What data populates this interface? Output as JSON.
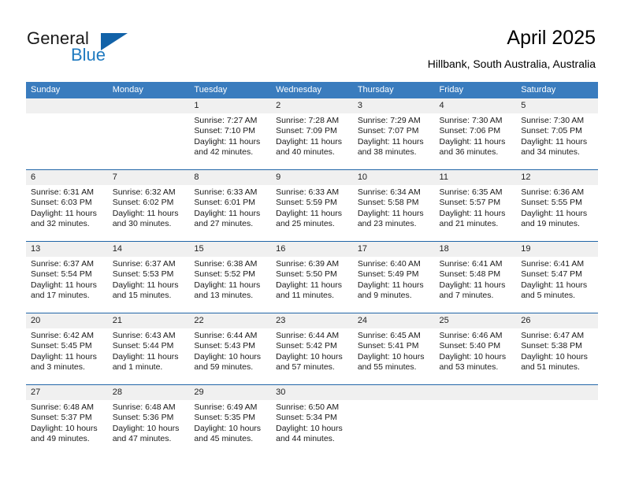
{
  "brand": {
    "line1": "General",
    "line2": "Blue",
    "accent_color": "#1262a8",
    "logo_icon": "triangle-logo-icon"
  },
  "header": {
    "title": "April 2025",
    "subtitle": "Hillbank, South Australia, Australia"
  },
  "theme": {
    "header_row_bg": "#3a7cbe",
    "row_divider": "#2266a8",
    "daynum_band_bg": "#f0f0f0",
    "text": "#000000"
  },
  "calendar": {
    "weekday_headers": [
      "Sunday",
      "Monday",
      "Tuesday",
      "Wednesday",
      "Thursday",
      "Friday",
      "Saturday"
    ],
    "weeks": [
      [
        {
          "day": "",
          "sunrise": "",
          "sunset": "",
          "daylight1": "",
          "daylight2": ""
        },
        {
          "day": "",
          "sunrise": "",
          "sunset": "",
          "daylight1": "",
          "daylight2": ""
        },
        {
          "day": "1",
          "sunrise": "Sunrise: 7:27 AM",
          "sunset": "Sunset: 7:10 PM",
          "daylight1": "Daylight: 11 hours",
          "daylight2": "and 42 minutes."
        },
        {
          "day": "2",
          "sunrise": "Sunrise: 7:28 AM",
          "sunset": "Sunset: 7:09 PM",
          "daylight1": "Daylight: 11 hours",
          "daylight2": "and 40 minutes."
        },
        {
          "day": "3",
          "sunrise": "Sunrise: 7:29 AM",
          "sunset": "Sunset: 7:07 PM",
          "daylight1": "Daylight: 11 hours",
          "daylight2": "and 38 minutes."
        },
        {
          "day": "4",
          "sunrise": "Sunrise: 7:30 AM",
          "sunset": "Sunset: 7:06 PM",
          "daylight1": "Daylight: 11 hours",
          "daylight2": "and 36 minutes."
        },
        {
          "day": "5",
          "sunrise": "Sunrise: 7:30 AM",
          "sunset": "Sunset: 7:05 PM",
          "daylight1": "Daylight: 11 hours",
          "daylight2": "and 34 minutes."
        }
      ],
      [
        {
          "day": "6",
          "sunrise": "Sunrise: 6:31 AM",
          "sunset": "Sunset: 6:03 PM",
          "daylight1": "Daylight: 11 hours",
          "daylight2": "and 32 minutes."
        },
        {
          "day": "7",
          "sunrise": "Sunrise: 6:32 AM",
          "sunset": "Sunset: 6:02 PM",
          "daylight1": "Daylight: 11 hours",
          "daylight2": "and 30 minutes."
        },
        {
          "day": "8",
          "sunrise": "Sunrise: 6:33 AM",
          "sunset": "Sunset: 6:01 PM",
          "daylight1": "Daylight: 11 hours",
          "daylight2": "and 27 minutes."
        },
        {
          "day": "9",
          "sunrise": "Sunrise: 6:33 AM",
          "sunset": "Sunset: 5:59 PM",
          "daylight1": "Daylight: 11 hours",
          "daylight2": "and 25 minutes."
        },
        {
          "day": "10",
          "sunrise": "Sunrise: 6:34 AM",
          "sunset": "Sunset: 5:58 PM",
          "daylight1": "Daylight: 11 hours",
          "daylight2": "and 23 minutes."
        },
        {
          "day": "11",
          "sunrise": "Sunrise: 6:35 AM",
          "sunset": "Sunset: 5:57 PM",
          "daylight1": "Daylight: 11 hours",
          "daylight2": "and 21 minutes."
        },
        {
          "day": "12",
          "sunrise": "Sunrise: 6:36 AM",
          "sunset": "Sunset: 5:55 PM",
          "daylight1": "Daylight: 11 hours",
          "daylight2": "and 19 minutes."
        }
      ],
      [
        {
          "day": "13",
          "sunrise": "Sunrise: 6:37 AM",
          "sunset": "Sunset: 5:54 PM",
          "daylight1": "Daylight: 11 hours",
          "daylight2": "and 17 minutes."
        },
        {
          "day": "14",
          "sunrise": "Sunrise: 6:37 AM",
          "sunset": "Sunset: 5:53 PM",
          "daylight1": "Daylight: 11 hours",
          "daylight2": "and 15 minutes."
        },
        {
          "day": "15",
          "sunrise": "Sunrise: 6:38 AM",
          "sunset": "Sunset: 5:52 PM",
          "daylight1": "Daylight: 11 hours",
          "daylight2": "and 13 minutes."
        },
        {
          "day": "16",
          "sunrise": "Sunrise: 6:39 AM",
          "sunset": "Sunset: 5:50 PM",
          "daylight1": "Daylight: 11 hours",
          "daylight2": "and 11 minutes."
        },
        {
          "day": "17",
          "sunrise": "Sunrise: 6:40 AM",
          "sunset": "Sunset: 5:49 PM",
          "daylight1": "Daylight: 11 hours",
          "daylight2": "and 9 minutes."
        },
        {
          "day": "18",
          "sunrise": "Sunrise: 6:41 AM",
          "sunset": "Sunset: 5:48 PM",
          "daylight1": "Daylight: 11 hours",
          "daylight2": "and 7 minutes."
        },
        {
          "day": "19",
          "sunrise": "Sunrise: 6:41 AM",
          "sunset": "Sunset: 5:47 PM",
          "daylight1": "Daylight: 11 hours",
          "daylight2": "and 5 minutes."
        }
      ],
      [
        {
          "day": "20",
          "sunrise": "Sunrise: 6:42 AM",
          "sunset": "Sunset: 5:45 PM",
          "daylight1": "Daylight: 11 hours",
          "daylight2": "and 3 minutes."
        },
        {
          "day": "21",
          "sunrise": "Sunrise: 6:43 AM",
          "sunset": "Sunset: 5:44 PM",
          "daylight1": "Daylight: 11 hours",
          "daylight2": "and 1 minute."
        },
        {
          "day": "22",
          "sunrise": "Sunrise: 6:44 AM",
          "sunset": "Sunset: 5:43 PM",
          "daylight1": "Daylight: 10 hours",
          "daylight2": "and 59 minutes."
        },
        {
          "day": "23",
          "sunrise": "Sunrise: 6:44 AM",
          "sunset": "Sunset: 5:42 PM",
          "daylight1": "Daylight: 10 hours",
          "daylight2": "and 57 minutes."
        },
        {
          "day": "24",
          "sunrise": "Sunrise: 6:45 AM",
          "sunset": "Sunset: 5:41 PM",
          "daylight1": "Daylight: 10 hours",
          "daylight2": "and 55 minutes."
        },
        {
          "day": "25",
          "sunrise": "Sunrise: 6:46 AM",
          "sunset": "Sunset: 5:40 PM",
          "daylight1": "Daylight: 10 hours",
          "daylight2": "and 53 minutes."
        },
        {
          "day": "26",
          "sunrise": "Sunrise: 6:47 AM",
          "sunset": "Sunset: 5:38 PM",
          "daylight1": "Daylight: 10 hours",
          "daylight2": "and 51 minutes."
        }
      ],
      [
        {
          "day": "27",
          "sunrise": "Sunrise: 6:48 AM",
          "sunset": "Sunset: 5:37 PM",
          "daylight1": "Daylight: 10 hours",
          "daylight2": "and 49 minutes."
        },
        {
          "day": "28",
          "sunrise": "Sunrise: 6:48 AM",
          "sunset": "Sunset: 5:36 PM",
          "daylight1": "Daylight: 10 hours",
          "daylight2": "and 47 minutes."
        },
        {
          "day": "29",
          "sunrise": "Sunrise: 6:49 AM",
          "sunset": "Sunset: 5:35 PM",
          "daylight1": "Daylight: 10 hours",
          "daylight2": "and 45 minutes."
        },
        {
          "day": "30",
          "sunrise": "Sunrise: 6:50 AM",
          "sunset": "Sunset: 5:34 PM",
          "daylight1": "Daylight: 10 hours",
          "daylight2": "and 44 minutes."
        },
        {
          "day": "",
          "sunrise": "",
          "sunset": "",
          "daylight1": "",
          "daylight2": ""
        },
        {
          "day": "",
          "sunrise": "",
          "sunset": "",
          "daylight1": "",
          "daylight2": ""
        },
        {
          "day": "",
          "sunrise": "",
          "sunset": "",
          "daylight1": "",
          "daylight2": ""
        }
      ]
    ]
  }
}
